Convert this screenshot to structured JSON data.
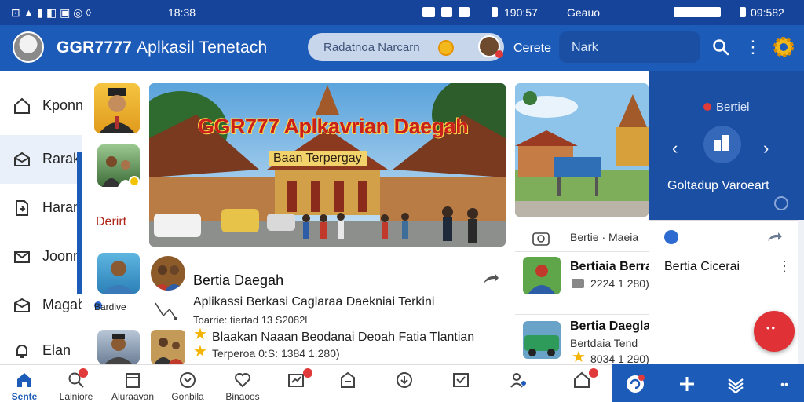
{
  "status_bar": {
    "left_icons": "⊡ ▲ ▮ ◧ ▣ ◎ ◊",
    "time_left": "18:38",
    "clock": "190:57",
    "center_label": "Geauo",
    "right_time": "09:582"
  },
  "header": {
    "app_name": "GGR7777",
    "app_subtitle": "Aplkasil Tenetach",
    "search_placeholder": "Radatnoa Narcarn",
    "link_label": "Cerete",
    "search2_placeholder": "Nark"
  },
  "sidebar": {
    "items": [
      {
        "label": "Kponn",
        "icon": "home-icon"
      },
      {
        "label": "Rarak",
        "icon": "mail-open-icon"
      },
      {
        "label": "Haram",
        "icon": "file-arrow-icon"
      },
      {
        "label": "Joonne",
        "icon": "envelope-icon"
      },
      {
        "label": "Magab",
        "icon": "inbox-icon"
      },
      {
        "label": "Elan",
        "icon": "bell-icon"
      }
    ]
  },
  "stories": {
    "label": "Derirt",
    "caption": "Bardive"
  },
  "hero": {
    "title": "GGR777 Aplkavrian Daegah",
    "subtitle": "Baan Terpergay"
  },
  "post": {
    "name": "Bertia Daegah",
    "line1": "Aplikassi Berkasi Caglaraa Daekniai Terkini",
    "meta1": "Toarrie: tiertad 13 S2082l",
    "line2": "Blaakan Naaan Beodanai Deoah Fatia Tlantian",
    "meta2": "Terperoa 0:S: 1384 1.280)"
  },
  "right_column": {
    "meta": "Bertie · Maeia",
    "rows": [
      {
        "title": "Bertiaia Berra",
        "sub": "2224 1 280)"
      },
      {
        "title": "Bertia Daegla",
        "sub": "Bertdaia Tend"
      },
      {
        "title": "",
        "sub": "8034 1 290)"
      }
    ]
  },
  "blue_panel": {
    "label": "Bertiel",
    "caption": "Goltadup Varoeart"
  },
  "popup_card": {
    "title": "Bertia Cicerai"
  },
  "bottom_nav": {
    "items": [
      {
        "label": "Sente",
        "icon": "home-icon"
      },
      {
        "label": "Lainiore",
        "icon": "search-icon"
      },
      {
        "label": "Aluraavan",
        "icon": "calendar-icon"
      },
      {
        "label": "Gonbila",
        "icon": "chevron-circle-icon"
      },
      {
        "label": "Binaoos",
        "icon": "heart-icon"
      },
      {
        "label": "",
        "icon": "chart-icon"
      },
      {
        "label": "",
        "icon": "store-icon"
      },
      {
        "label": "",
        "icon": "download-icon"
      },
      {
        "label": "",
        "icon": "check-icon"
      },
      {
        "label": "",
        "icon": "people-icon"
      },
      {
        "label": "",
        "icon": "home-badge-icon"
      }
    ]
  },
  "colors": {
    "primary": "#1d5bb8",
    "primary_dark": "#17449b",
    "accent_red": "#e03236",
    "accent_yellow": "#f2b81c"
  }
}
